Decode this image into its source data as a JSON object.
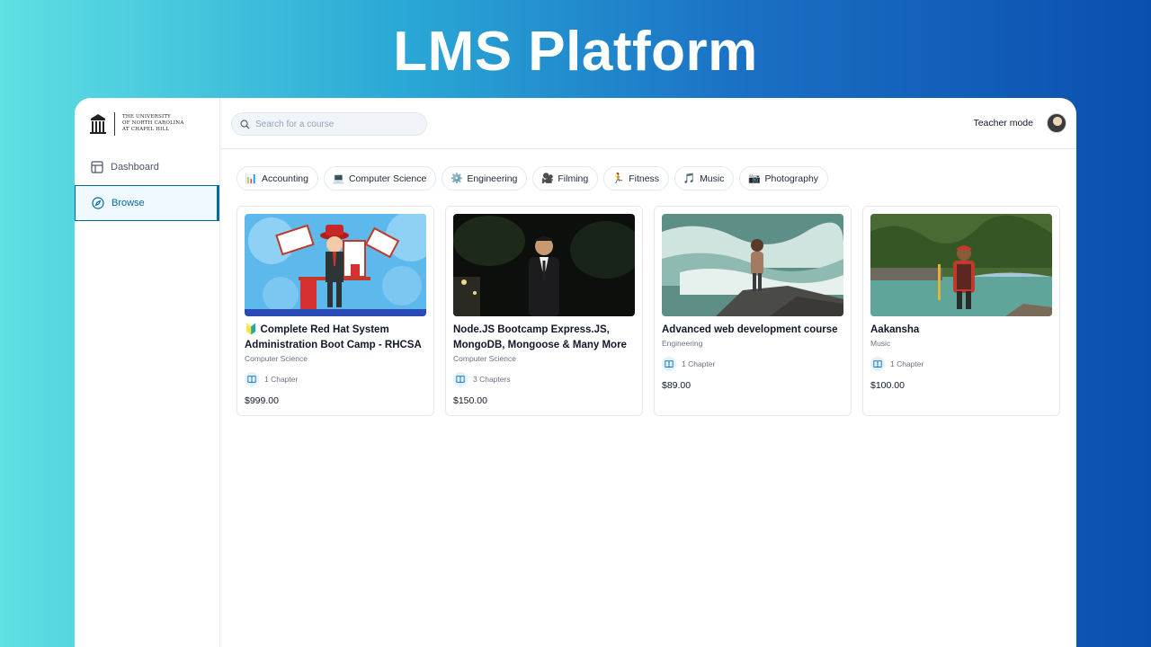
{
  "banner": {
    "title": "LMS Platform"
  },
  "sidebar": {
    "logo": {
      "line1": "THE UNIVERSITY",
      "line2": "of NORTH CAROLINA",
      "line3": "at CHAPEL HILL"
    },
    "items": [
      {
        "label": "Dashboard",
        "icon": "layout-icon",
        "active": false
      },
      {
        "label": "Browse",
        "icon": "compass-icon",
        "active": true
      }
    ]
  },
  "topbar": {
    "search": {
      "placeholder": "Search for a course",
      "value": ""
    },
    "teacher_mode": "Teacher mode"
  },
  "categories": [
    {
      "label": "Accounting",
      "icon": "📊"
    },
    {
      "label": "Computer Science",
      "icon": "💻"
    },
    {
      "label": "Engineering",
      "icon": "⚙️"
    },
    {
      "label": "Filming",
      "icon": "🎥"
    },
    {
      "label": "Fitness",
      "icon": "🏃"
    },
    {
      "label": "Music",
      "icon": "🎵"
    },
    {
      "label": "Photography",
      "icon": "📷"
    }
  ],
  "courses": [
    {
      "title": "🔰 Complete Red Hat System Administration Boot Camp - RHCSA",
      "category": "Computer Science",
      "chapters": "1 Chapter",
      "price": "$999.00"
    },
    {
      "title": "Node.JS Bootcamp Express.JS, MongoDB, Mongoose & Many More",
      "category": "Computer Science",
      "chapters": "3 Chapters",
      "price": "$150.00"
    },
    {
      "title": "Advanced web development course",
      "category": "Engineering",
      "chapters": "1 Chapter",
      "price": "$89.00"
    },
    {
      "title": "Aakansha",
      "category": "Music",
      "chapters": "1 Chapter",
      "price": "$100.00"
    }
  ],
  "colors": {
    "accent": "#0369a1",
    "accent_bg": "#f0f9ff"
  }
}
